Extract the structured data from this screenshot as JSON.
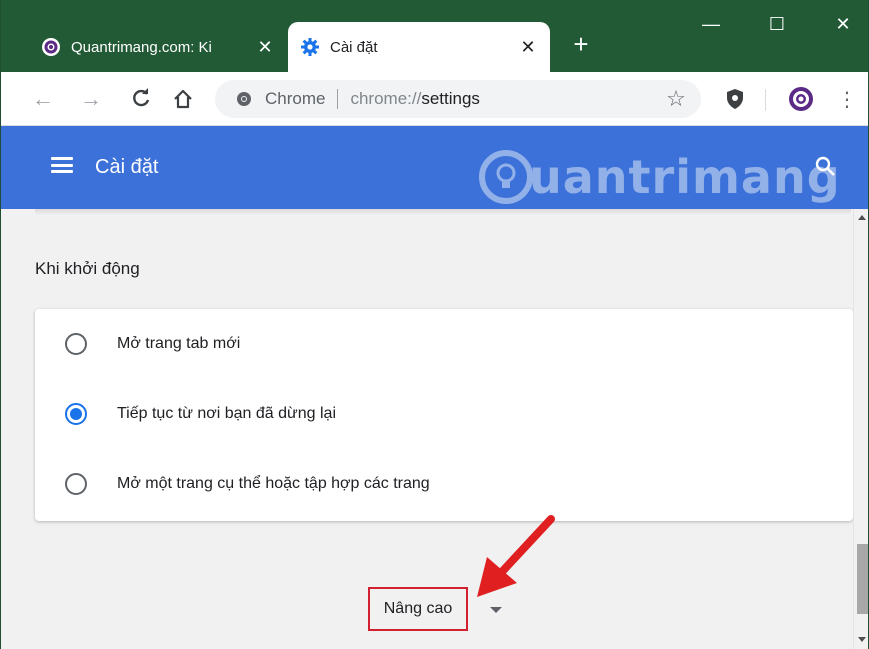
{
  "tabs": [
    {
      "title": "Quantrimang.com: Ki",
      "favicon": "quantrimang-logo-icon",
      "close": "✕"
    },
    {
      "title": "Cài đặt",
      "favicon": "settings-gear-icon",
      "close": "✕"
    }
  ],
  "new_tab_label": "+",
  "window_controls": {
    "minimize": "—",
    "maximize": "☐",
    "close": "✕"
  },
  "toolbar": {
    "back": "←",
    "forward": "→",
    "reload": "C",
    "home": "⌂",
    "star": "☆",
    "menu": "⋮"
  },
  "omnibox": {
    "site_chip": "Chrome",
    "scheme": "chrome://",
    "path": "settings"
  },
  "settings": {
    "header_title": "Cài đặt",
    "watermark": "uantrimang",
    "section_title": "Khi khởi động",
    "options": [
      {
        "label": "Mở trang tab mới",
        "checked": false
      },
      {
        "label": "Tiếp tục từ nơi bạn đã dừng lại",
        "checked": true
      },
      {
        "label": "Mở một trang cụ thể hoặc tập hợp các trang",
        "checked": false
      }
    ],
    "advanced_label": "Nâng cao"
  },
  "colors": {
    "titlebar": "#235a36",
    "header": "#3b71d8",
    "accent": "#1a73e8",
    "highlight_box": "#d32030",
    "arrow": "#e02020"
  }
}
